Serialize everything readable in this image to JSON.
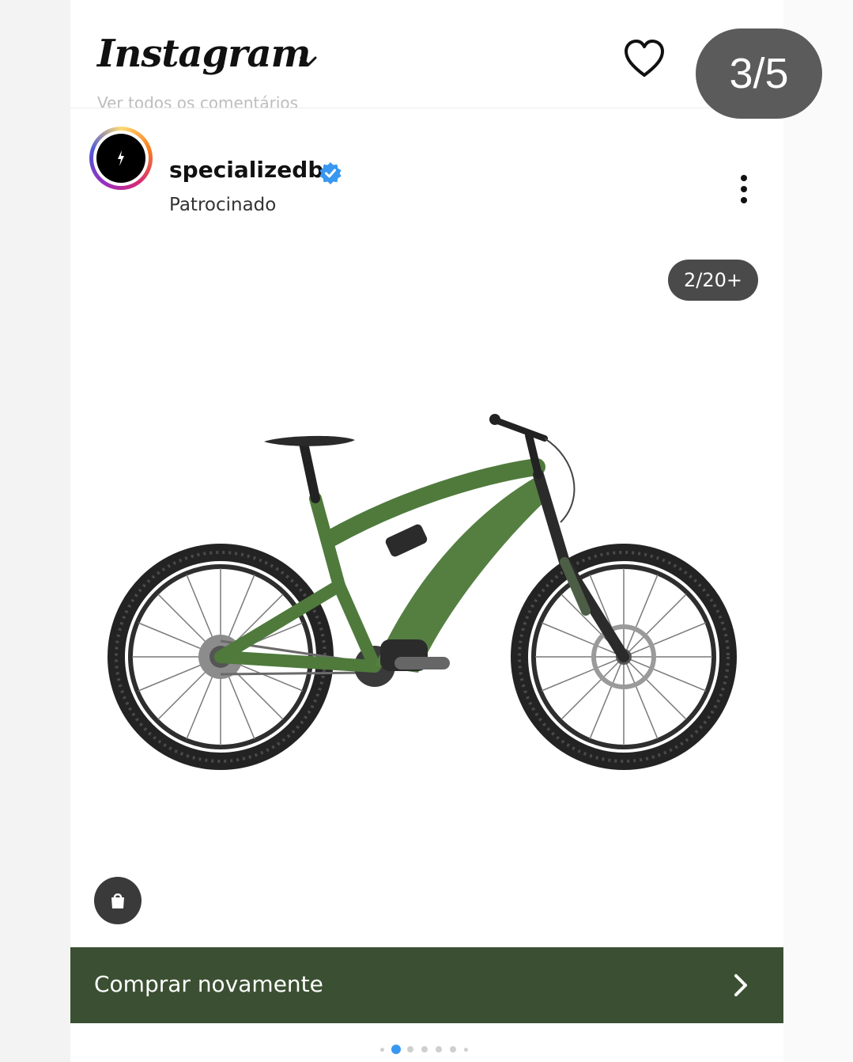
{
  "screenshot_counter": "3/5",
  "header": {
    "logo": "Instagram",
    "ghost_text": "Ver todos os comentários",
    "icons": [
      "chevron-down-icon",
      "heart-icon",
      "messenger-icon"
    ]
  },
  "post": {
    "username": "specializedbr",
    "verified": true,
    "subtitle": "Patrocinado",
    "media_counter": "2/20+",
    "media_subject": "green electric mountain bike",
    "cta_label": "Comprar novamente",
    "carousel_active_index": 1,
    "carousel_dot_count": 7
  },
  "colors": {
    "cta_background": "#3b5032",
    "bike_frame": "#4f7a3c",
    "verified_badge": "#3897f0",
    "pill_background": "#5b5b5b"
  }
}
